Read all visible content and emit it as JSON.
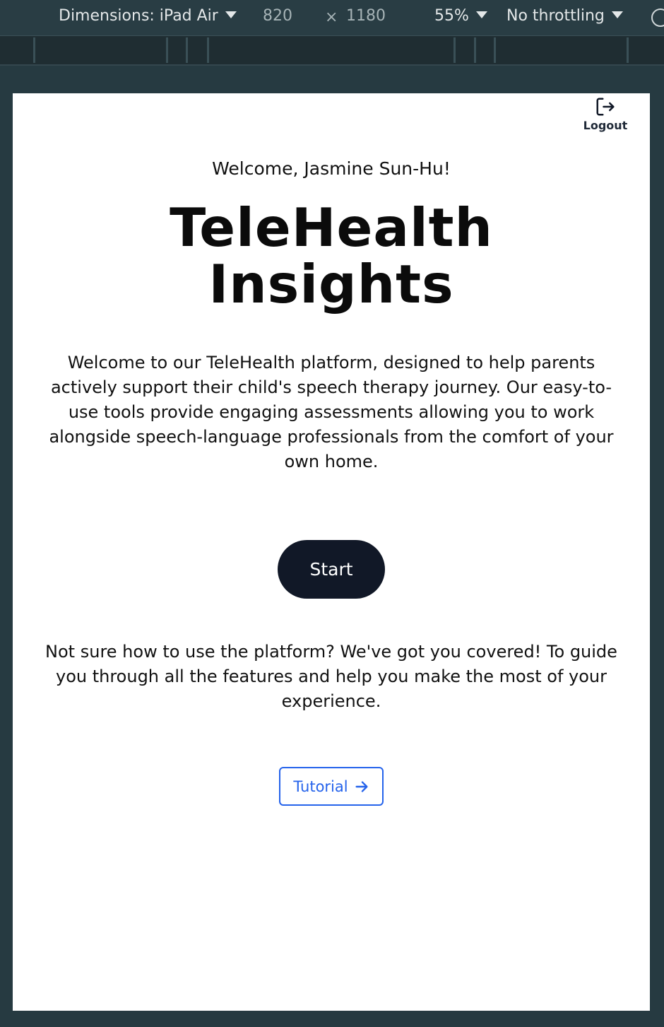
{
  "devtools": {
    "dimensions_label": "Dimensions: iPad Air",
    "width": "820",
    "times": "×",
    "height": "1180",
    "zoom": "55%",
    "throttling": "No throttling"
  },
  "header": {
    "logout_label": "Logout",
    "logout_icon": "logout-icon"
  },
  "main": {
    "welcome": "Welcome, Jasmine Sun-Hu!",
    "title_line1": "TeleHealth",
    "title_line2": "Insights",
    "intro": "Welcome to our TeleHealth platform, designed to help parents actively support their child's speech therapy journey. Our easy-to-use tools provide engaging assessments allowing you to work alongside speech-language professionals from the comfort of your own home.",
    "start_label": "Start",
    "help_text": "Not sure how to use the platform? We've got you covered! To guide you through all the features and help you make the most of your experience.",
    "tutorial_label": "Tutorial",
    "tutorial_icon": "arrow-right-icon"
  },
  "colors": {
    "start_bg": "#111827",
    "tutorial_accent": "#2563eb",
    "devtools_bg": "#293d44"
  }
}
